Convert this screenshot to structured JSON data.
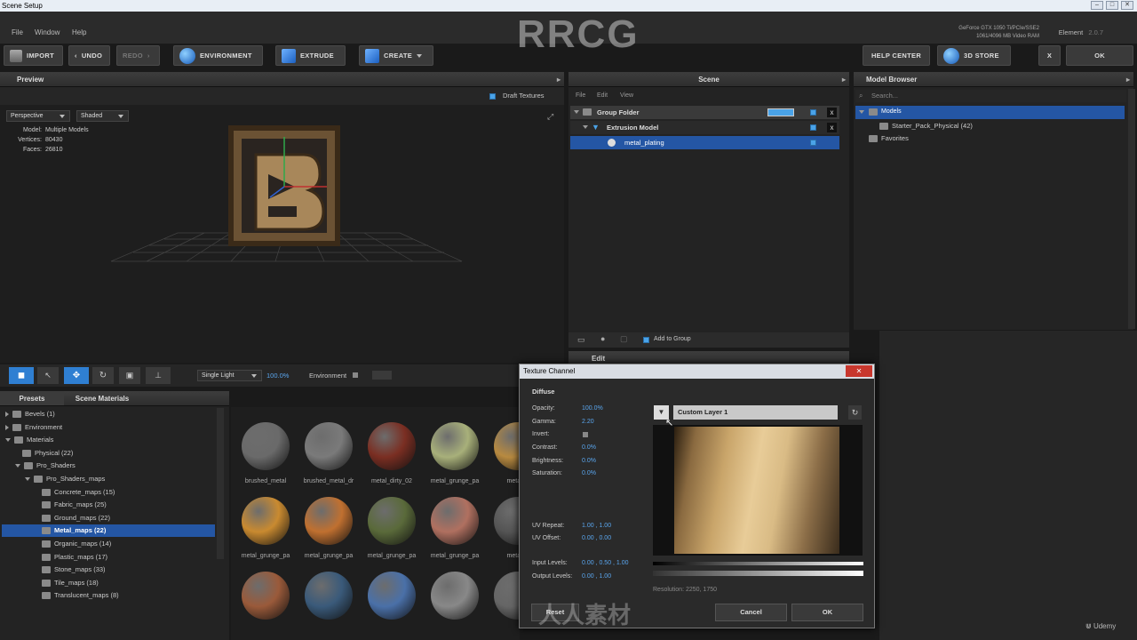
{
  "window": {
    "title": "Scene Setup"
  },
  "menu": [
    "File",
    "Window",
    "Help"
  ],
  "toolbar": {
    "import": "IMPORT",
    "undo": "UNDO",
    "redo": "REDO",
    "environment": "ENVIRONMENT",
    "extrude": "EXTRUDE",
    "create": "CREATE",
    "help_center": "HELP CENTER",
    "store": "3D STORE",
    "close": "X",
    "ok": "OK"
  },
  "gpu": {
    "line1": "GeForce GTX 1050 Ti/PCIe/SSE2",
    "line2": "1061/4096 MB Video RAM"
  },
  "element": {
    "label": "Element",
    "version": "2.0.7"
  },
  "watermark": "RRCG",
  "preview": {
    "title": "Preview",
    "draft_textures": "Draft Textures",
    "view_mode": "Perspective",
    "shading": "Shaded",
    "model_label": "Model:",
    "model_value": "Multiple Models",
    "vertices_label": "Vertices:",
    "vertices_value": "80430",
    "faces_label": "Faces:",
    "faces_value": "26810",
    "light": "Single Light",
    "light_pct": "100.0%",
    "environment": "Environment"
  },
  "scene": {
    "title": "Scene",
    "menu": [
      "File",
      "Edit",
      "View"
    ],
    "group_folder": "Group Folder",
    "extrusion_model": "Extrusion Model",
    "material": "metal_plating",
    "add_to_group": "Add to Group",
    "edit": "Edit"
  },
  "model_browser": {
    "title": "Model Browser",
    "search_placeholder": "Search...",
    "models": "Models",
    "starter_pack": "Starter_Pack_Physical (42)",
    "favorites": "Favorites"
  },
  "presets": {
    "tab1": "Presets",
    "tab2": "Scene Materials",
    "tree": [
      {
        "label": "Bevels (1)",
        "indent": 0,
        "state": "closed"
      },
      {
        "label": "Environment",
        "indent": 0,
        "state": "closed"
      },
      {
        "label": "Materials",
        "indent": 0,
        "state": "open"
      },
      {
        "label": "Physical (22)",
        "indent": 1,
        "state": "none"
      },
      {
        "label": "Pro_Shaders",
        "indent": 1,
        "state": "open"
      },
      {
        "label": "Pro_Shaders_maps",
        "indent": 2,
        "state": "open"
      },
      {
        "label": "Concrete_maps (15)",
        "indent": 3,
        "state": "none"
      },
      {
        "label": "Fabric_maps (25)",
        "indent": 3,
        "state": "none"
      },
      {
        "label": "Ground_maps (22)",
        "indent": 3,
        "state": "none"
      },
      {
        "label": "Metal_maps (22)",
        "indent": 3,
        "state": "selected"
      },
      {
        "label": "Organic_maps (14)",
        "indent": 3,
        "state": "none"
      },
      {
        "label": "Plastic_maps (17)",
        "indent": 3,
        "state": "none"
      },
      {
        "label": "Stone_maps (33)",
        "indent": 3,
        "state": "none"
      },
      {
        "label": "Tile_maps (18)",
        "indent": 3,
        "state": "none"
      },
      {
        "label": "Translucent_maps (8)",
        "indent": 3,
        "state": "none"
      }
    ]
  },
  "materials": [
    {
      "label": "brushed_metal",
      "color": "#6a6a6a"
    },
    {
      "label": "brushed_metal_dr",
      "color": "#7a7a7a"
    },
    {
      "label": "metal_dirty_02",
      "color": "#7a2e22"
    },
    {
      "label": "metal_grunge_pa",
      "color": "#a8b07a"
    },
    {
      "label": "metal_g",
      "color": "#b88a40"
    },
    {
      "label": "metal_grunge_pa",
      "color": "#c98a30"
    },
    {
      "label": "metal_grunge_pa",
      "color": "#c07030"
    },
    {
      "label": "metal_grunge_pa",
      "color": "#5a6a3a"
    },
    {
      "label": "metal_grunge_pa",
      "color": "#b07060"
    },
    {
      "label": "metal_g",
      "color": "#555555"
    },
    {
      "label": "",
      "color": "#9a5a3a"
    },
    {
      "label": "",
      "color": "#3a5a7a"
    },
    {
      "label": "",
      "color": "#4a70a8"
    },
    {
      "label": "",
      "color": "#888888"
    },
    {
      "label": "",
      "color": "#666666"
    }
  ],
  "dialog": {
    "title": "Texture Channel",
    "section": "Diffuse",
    "opacity_label": "Opacity:",
    "opacity": "100.0%",
    "gamma_label": "Gamma:",
    "gamma": "2.20",
    "invert_label": "Invert:",
    "contrast_label": "Contrast:",
    "contrast": "0.0%",
    "brightness_label": "Brightness:",
    "brightness": "0.0%",
    "saturation_label": "Saturation:",
    "saturation": "0.0%",
    "uv_repeat_label": "UV Repeat:",
    "uv_repeat": "1.00 ,  1.00",
    "uv_offset_label": "UV Offset:",
    "uv_offset": "0.00 ,  0.00",
    "input_levels_label": "Input Levels:",
    "input_levels": "0.00 ,  0.50 ,  1.00",
    "output_levels_label": "Output Levels:",
    "output_levels": "0.00 ,  1.00",
    "layer": "Custom Layer 1",
    "resolution": "Resolution: 2250, 1750",
    "reset": "Reset",
    "cancel": "Cancel",
    "ok": "OK"
  },
  "udemy": "Udemy",
  "footer_wm": "人人素材"
}
